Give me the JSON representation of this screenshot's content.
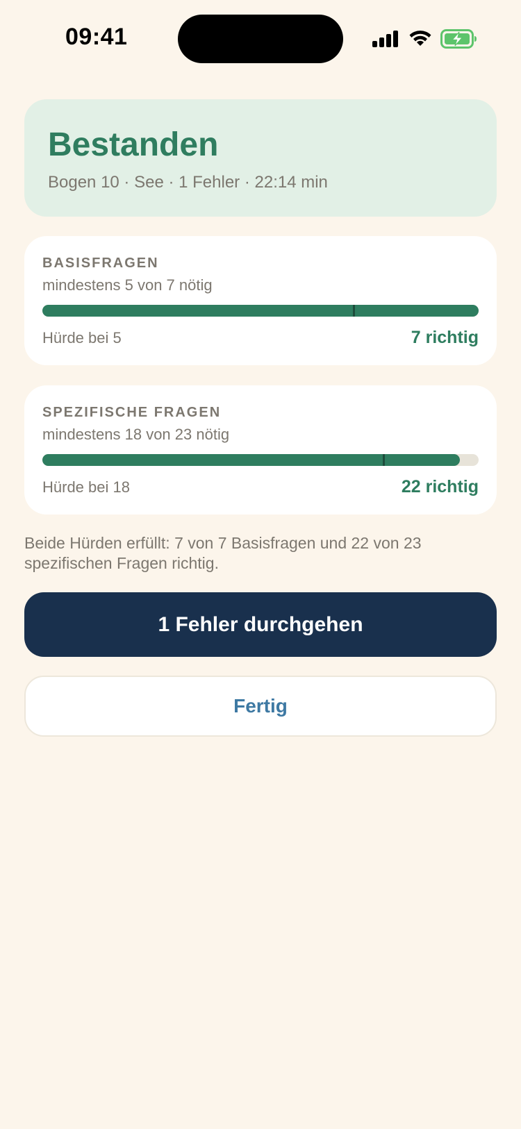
{
  "status_bar": {
    "time": "09:41",
    "icons": [
      "signal-icon",
      "wifi-icon",
      "battery-charging-icon"
    ]
  },
  "result": {
    "title": "Bestanden",
    "subtitle": "Bogen 10 · See · 1 Fehler · 22:14 min",
    "color": "#2F7D5F",
    "background": "#E2F0E6"
  },
  "sections": {
    "basis": {
      "label": "BASISFRAGEN",
      "requirement": "mindestens 5 von 7 nötig",
      "threshold_text": "Hürde bei 5",
      "result_text": "7 richtig",
      "correct": 7,
      "total": 7,
      "threshold": 5
    },
    "spezifisch": {
      "label": "SPEZIFISCHE FRAGEN",
      "requirement": "mindestens 18 von 23 nötig",
      "threshold_text": "Hürde bei 18",
      "result_text": "22 richtig",
      "correct": 22,
      "total": 23,
      "threshold": 18
    }
  },
  "summary": "Beide Hürden erfüllt: 7 von 7 Basisfragen und 22 von 23 spezifischen Fragen richtig.",
  "buttons": {
    "review_label": "1 Fehler durchgehen",
    "done_label": "Fertig"
  },
  "colors": {
    "background": "#FCF5EB",
    "accent_green": "#2E7D5F",
    "primary_button": "#19304D",
    "link_blue": "#3E79A3",
    "muted_text": "#7C776F"
  }
}
